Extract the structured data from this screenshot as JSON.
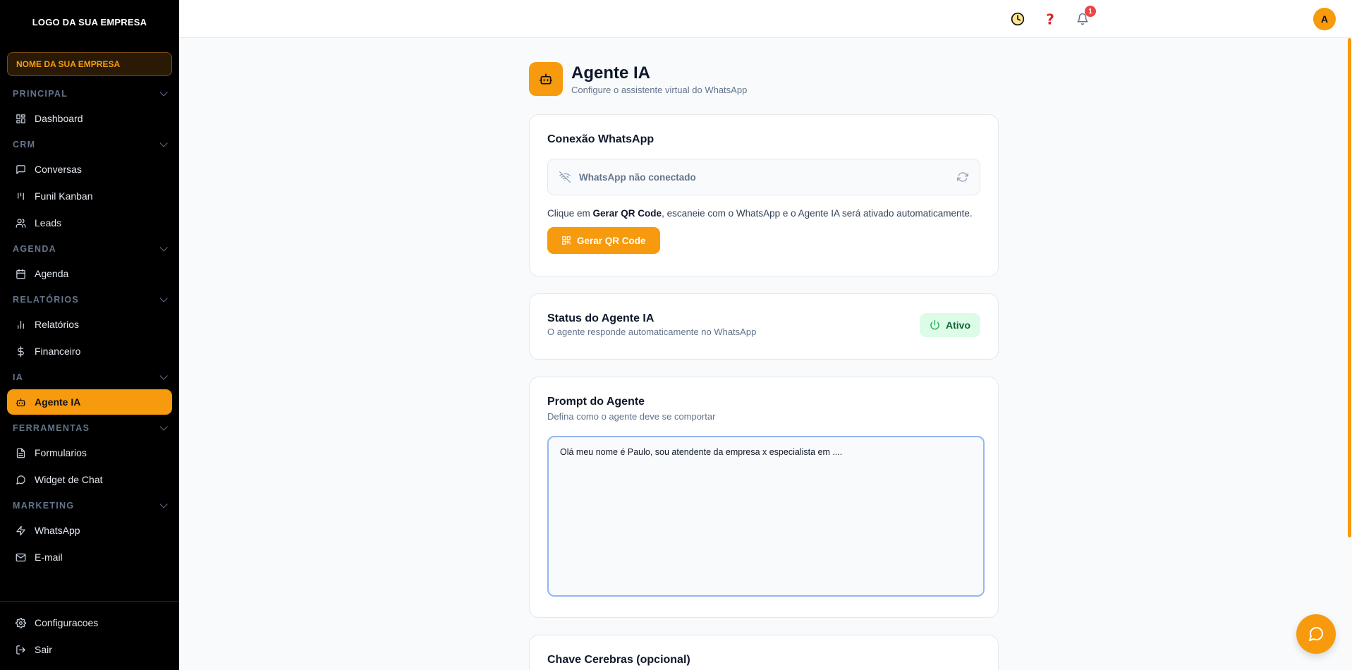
{
  "sidebar": {
    "logo": "LOGO DA SUA EMPRESA",
    "company": "NOME DA SUA EMPRESA",
    "sections": {
      "principal": "PRINCIPAL",
      "crm": "CRM",
      "agenda": "AGENDA",
      "relatorios": "RELATÓRIOS",
      "ia": "IA",
      "ferramentas": "FERRAMENTAS",
      "marketing": "MARKETING"
    },
    "items": {
      "dashboard": "Dashboard",
      "conversas": "Conversas",
      "funil": "Funil Kanban",
      "leads": "Leads",
      "agenda": "Agenda",
      "relatorios": "Relatórios",
      "financeiro": "Financeiro",
      "agente": "Agente IA",
      "formularios": "Formularios",
      "widget": "Widget de Chat",
      "whatsapp": "WhatsApp",
      "email": "E-mail",
      "configuracoes": "Configuracoes",
      "sair": "Sair"
    }
  },
  "topbar": {
    "notifications_count": "1",
    "avatar_initial": "A"
  },
  "header": {
    "title": "Agente IA",
    "subtitle": "Configure o assistente virtual do WhatsApp"
  },
  "whatsapp_card": {
    "title": "Conexão WhatsApp",
    "status": "WhatsApp não conectado",
    "hint_prefix": "Clique em ",
    "hint_bold": "Gerar QR Code",
    "hint_suffix": ", escaneie com o WhatsApp e o Agente IA será ativado automaticamente.",
    "button": "Gerar QR Code"
  },
  "status_card": {
    "title": "Status do Agente IA",
    "subtitle": "O agente responde automaticamente no WhatsApp",
    "status": "Ativo"
  },
  "prompt_card": {
    "title": "Prompt do Agente",
    "subtitle": "Defina como o agente deve se comportar",
    "value": "Olá meu nome é Paulo, sou atendente da empresa x especialista em ...."
  },
  "cerebras_card": {
    "title": "Chave Cerebras (opcional)"
  },
  "colors": {
    "accent": "#f79a0e",
    "sidebar_bg": "#000000",
    "success_bg": "#dcfce7",
    "success_text": "#166534"
  }
}
